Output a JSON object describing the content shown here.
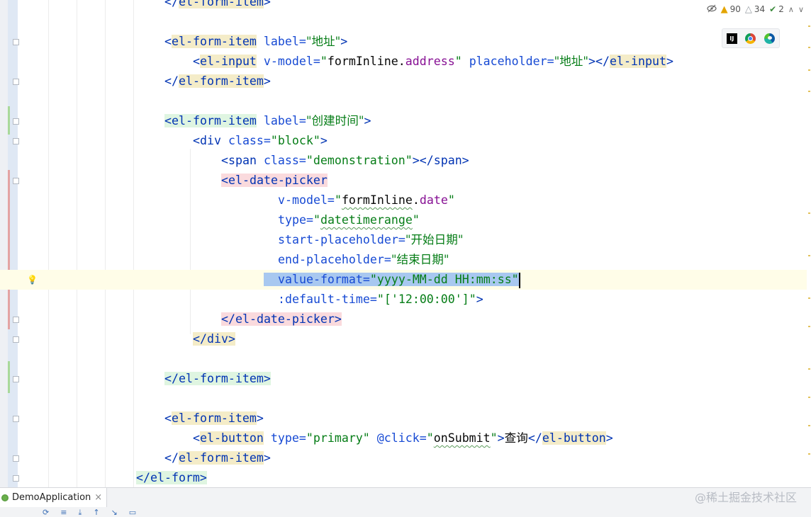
{
  "inspection": {
    "warnings": "90",
    "weak_warnings": "34",
    "typos": "2"
  },
  "browsers": {
    "items": [
      "intellij-icon",
      "chrome-icon",
      "edge-icon"
    ]
  },
  "code": {
    "l01": {
      "a": "</",
      "b": "el-form-item",
      "c": ">"
    },
    "l03": {
      "a": "<",
      "b": "el-form-item",
      "c": " label=",
      "d": "\"地址\"",
      "e": ">"
    },
    "l04": {
      "a": "<",
      "b": "el-input",
      "c": " v-model=",
      "d": "\"",
      "e": "formInline",
      "f": ".",
      "g": "address",
      "h": "\"",
      "i": " placeholder=",
      "j": "\"地址\"",
      "k": "></",
      "l": "el-input",
      "m": ">"
    },
    "l05": {
      "a": "</",
      "b": "el-form-item",
      "c": ">"
    },
    "l07": {
      "a": "<",
      "b": "el-form-item",
      "c": " label=",
      "d": "\"创建时间\"",
      "e": ">"
    },
    "l08": {
      "a": "<div",
      "b": " class=",
      "c": "\"block\"",
      "d": ">"
    },
    "l09": {
      "a": "<span",
      "b": " class=",
      "c": "\"demonstration\"",
      "d": "></span>"
    },
    "l10": {
      "a": "<",
      "b": "el-date-picker"
    },
    "l11": {
      "a": "v-model=",
      "b": "\"",
      "c": "formInline",
      "d": ".",
      "e": "date",
      "f": "\""
    },
    "l12": {
      "a": "type=",
      "b": "\"",
      "c": "datetimerange",
      "d": "\""
    },
    "l13": {
      "a": "start-placeholder=",
      "b": "\"开始日期\""
    },
    "l14": {
      "a": "end-placeholder=",
      "b": "\"结束日期\""
    },
    "l15": {
      "a": "value-format=",
      "b": "\"yyyy-MM-dd HH:mm:ss\""
    },
    "l16": {
      "a": ":default-time=",
      "b": "\"['12:00:00']\"",
      "c": ">"
    },
    "l17": {
      "a": "</",
      "b": "el-date-picker",
      "c": ">"
    },
    "l18": {
      "a": "</div>"
    },
    "l20": {
      "a": "</",
      "b": "el-form-item",
      "c": ">"
    },
    "l22": {
      "a": "<",
      "b": "el-form-item",
      "c": ">"
    },
    "l23": {
      "a": "<",
      "b": "el-button",
      "c": " type=",
      "d": "\"primary\"",
      "e": " @click=",
      "f": "\"",
      "g": "onSubmit",
      "h": "\"",
      "i": ">",
      "j": "查询",
      "k": "</",
      "l": "el-button",
      "m": ">"
    },
    "l24": {
      "a": "</",
      "b": "el-form-item",
      "c": ">"
    },
    "l25": {
      "a": "</",
      "b": "el-form",
      "c": ">"
    }
  },
  "bottom": {
    "run_tab_label": "DemoApplication",
    "watermark": "@稀土掘金技术社区"
  },
  "colors": {
    "tag": "#0033b3",
    "attribute": "#174ad4",
    "string": "#067d17",
    "selection": "#a8c8f0",
    "current_line": "#fffde8"
  }
}
